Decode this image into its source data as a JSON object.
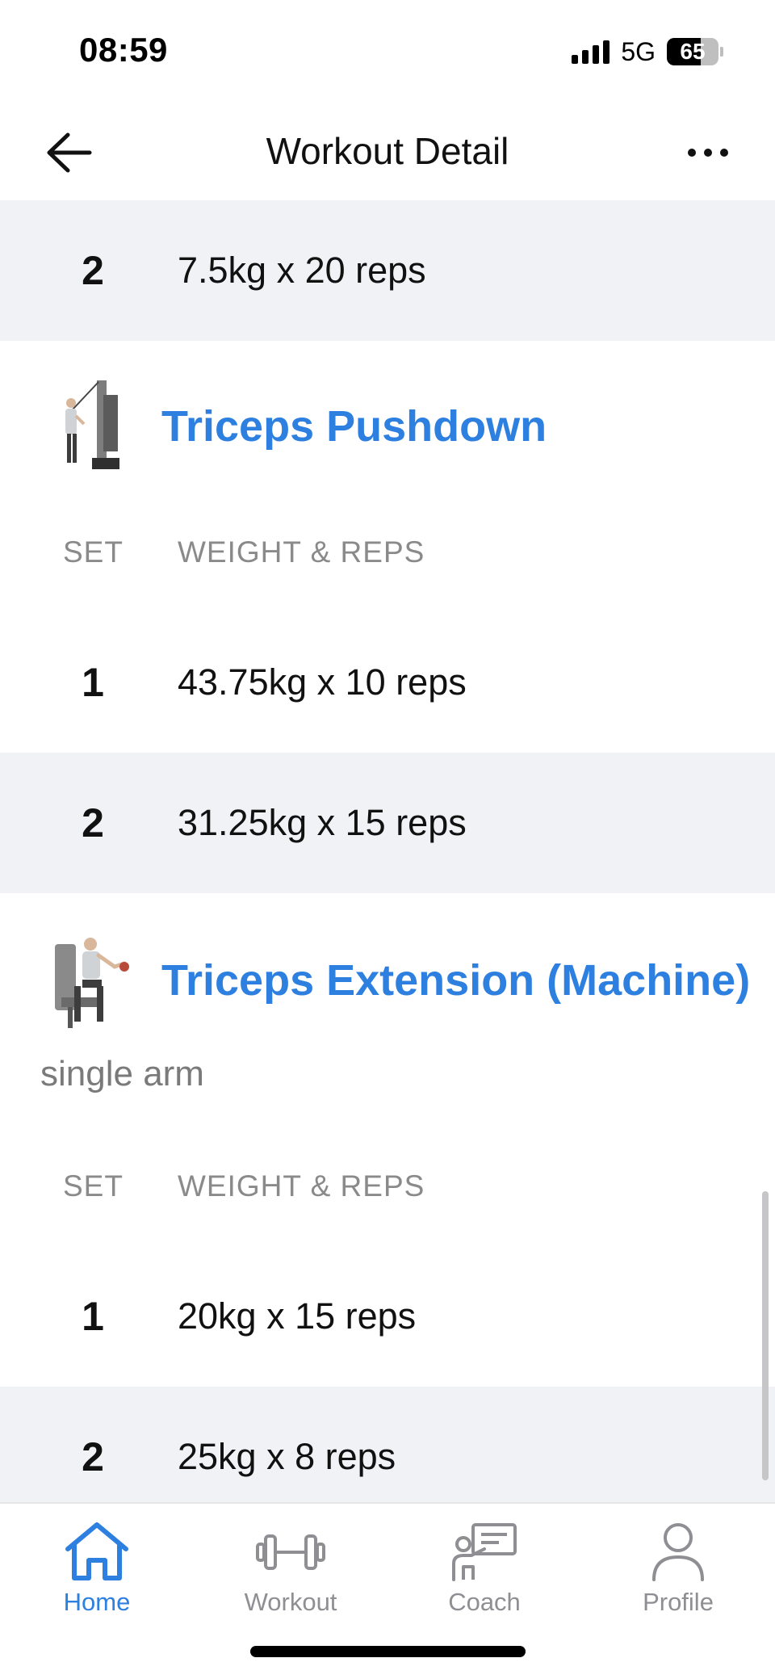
{
  "status_bar": {
    "time": "08:59",
    "network": "5G",
    "battery": "65",
    "battery_level": 0.65
  },
  "header": {
    "title": "Workout Detail",
    "back_icon": "arrow-left-icon",
    "more_icon": "more-horizontal-icon"
  },
  "previous_exercise": {
    "sets": [
      {
        "set": "2",
        "value": "7.5kg x 20 reps"
      }
    ]
  },
  "exercises": [
    {
      "name": "Triceps Pushdown",
      "note": "",
      "columns": {
        "set": "SET",
        "weight_reps": "WEIGHT & REPS"
      },
      "sets": [
        {
          "set": "1",
          "value": "43.75kg x 10 reps"
        },
        {
          "set": "2",
          "value": "31.25kg x 15 reps"
        }
      ]
    },
    {
      "name": "Triceps Extension (Machine)",
      "note": "single arm",
      "columns": {
        "set": "SET",
        "weight_reps": "WEIGHT & REPS"
      },
      "sets": [
        {
          "set": "1",
          "value": "20kg x 15 reps"
        },
        {
          "set": "2",
          "value": "25kg x 8 reps"
        }
      ]
    }
  ],
  "tab_bar": {
    "tabs": [
      {
        "label": "Home",
        "icon": "home-icon",
        "active": true
      },
      {
        "label": "Workout",
        "icon": "dumbbell-icon",
        "active": false
      },
      {
        "label": "Coach",
        "icon": "coach-icon",
        "active": false
      },
      {
        "label": "Profile",
        "icon": "profile-icon",
        "active": false
      }
    ]
  },
  "colors": {
    "accent": "#2d7fe0",
    "row_shade": "#f1f2f5",
    "muted_text": "#8a8a8a"
  }
}
